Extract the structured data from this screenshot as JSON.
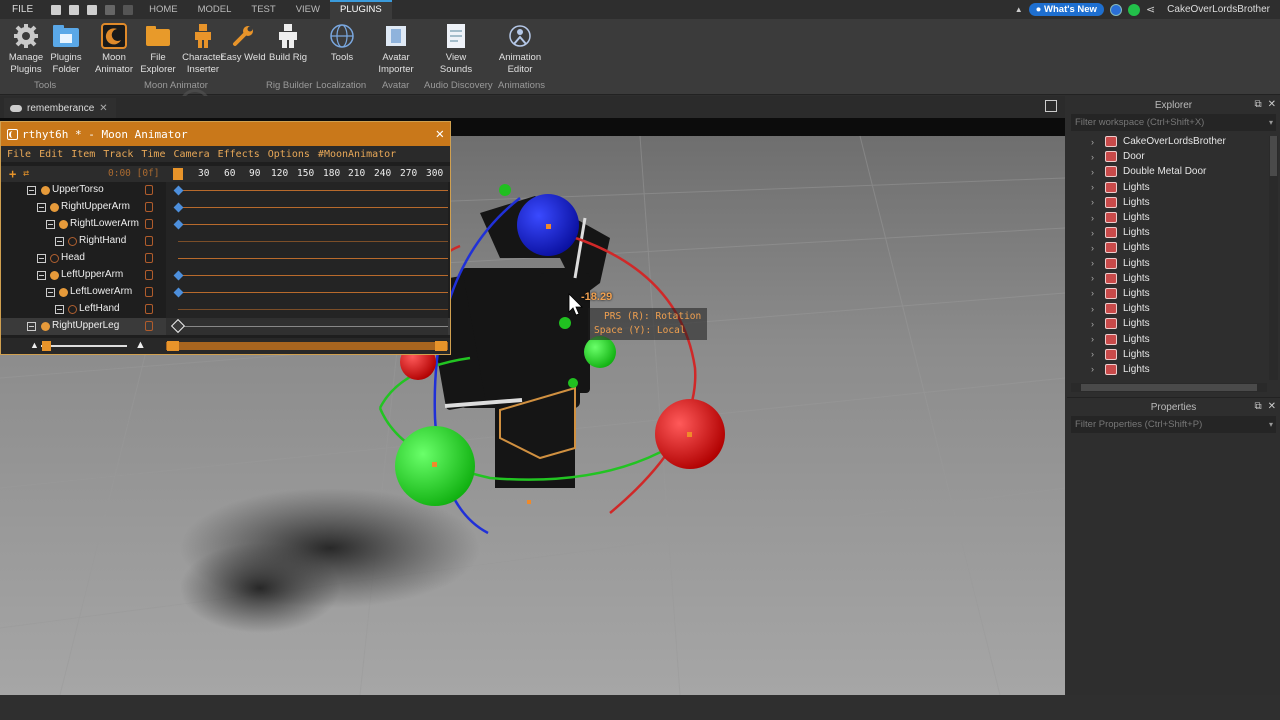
{
  "menubar": {
    "file_label": "FILE",
    "tabs": [
      {
        "label": "HOME"
      },
      {
        "label": "MODEL"
      },
      {
        "label": "TEST"
      },
      {
        "label": "VIEW"
      },
      {
        "label": "PLUGINS"
      }
    ],
    "whats_new": "What's New",
    "username": "CakeOverLordsBrother"
  },
  "ribbon": {
    "tools": {
      "manage": "Manage Plugins",
      "folder": "Plugins Folder",
      "group": "Tools"
    },
    "moon": {
      "moon_animator": "Moon Animator",
      "file_explorer": "File Explorer",
      "char_inserter": "Character Inserter",
      "easy_weld": "Easy Weld",
      "group": "Moon Animator"
    },
    "rig": {
      "build_rig": "Build Rig",
      "group": "Rig Builder"
    },
    "loc": {
      "tools": "Tools",
      "group": "Localization"
    },
    "avatar": {
      "importer": "Avatar Importer",
      "group": "Avatar"
    },
    "audio": {
      "view_sounds": "View Sounds",
      "group": "Audio Discovery"
    },
    "anim": {
      "editor": "Animation Editor",
      "group": "Animations"
    }
  },
  "doc_tab": {
    "title": "rememberance"
  },
  "moon_window": {
    "title": "rthyt6h * - Moon Animator",
    "menu": [
      "File",
      "Edit",
      "Item",
      "Track",
      "Time",
      "Camera",
      "Effects",
      "Options",
      "#MoonAnimator"
    ],
    "time_display": "0:00 [0f]",
    "ticks": [
      "30",
      "60",
      "90",
      "120",
      "150",
      "180",
      "210",
      "240",
      "270",
      "300"
    ],
    "rows": [
      {
        "name": "UpperTorso",
        "keyframe": true
      },
      {
        "name": "RightUpperArm",
        "keyframe": true
      },
      {
        "name": "RightLowerArm",
        "keyframe": true
      },
      {
        "name": "RightHand",
        "keyframe": false
      },
      {
        "name": "Head",
        "keyframe": false
      },
      {
        "name": "LeftUpperArm",
        "keyframe": true
      },
      {
        "name": "LeftLowerArm",
        "keyframe": true
      },
      {
        "name": "LeftHand",
        "keyframe": false
      },
      {
        "name": "RightUpperLeg",
        "keyframe": true
      }
    ]
  },
  "viewport": {
    "angle_readout": "-18.29",
    "tooltip_line1": "PRS (R): Rotation",
    "tooltip_line2": "Space (Y): Local"
  },
  "explorer": {
    "title": "Explorer",
    "filter_placeholder": "Filter workspace (Ctrl+Shift+X)",
    "items": [
      {
        "label": "CakeOverLordsBrother"
      },
      {
        "label": "Door"
      },
      {
        "label": "Double Metal Door"
      },
      {
        "label": "Lights"
      },
      {
        "label": "Lights"
      },
      {
        "label": "Lights"
      },
      {
        "label": "Lights"
      },
      {
        "label": "Lights"
      },
      {
        "label": "Lights"
      },
      {
        "label": "Lights"
      },
      {
        "label": "Lights"
      },
      {
        "label": "Lights"
      },
      {
        "label": "Lights"
      },
      {
        "label": "Lights"
      },
      {
        "label": "Lights"
      },
      {
        "label": "Lights"
      }
    ]
  },
  "properties": {
    "title": "Properties",
    "filter_placeholder": "Filter Properties (Ctrl+Shift+P)"
  },
  "colors": {
    "accent_blue": "#3a9bdc",
    "moon_orange": "#c9781a",
    "gizmo_red": "#e01818",
    "gizmo_green": "#22d622",
    "gizmo_blue": "#1a22d8"
  }
}
